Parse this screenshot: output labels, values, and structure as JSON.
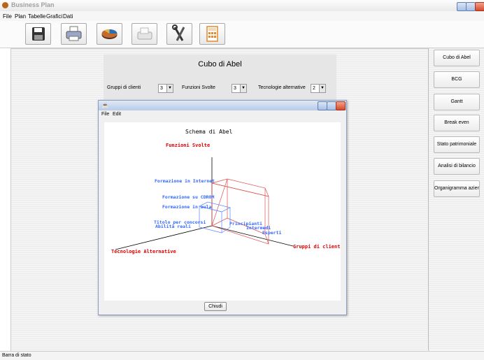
{
  "window": {
    "title": "Business Plan"
  },
  "menu": {
    "items": [
      "File",
      "Plan",
      "Tabelle",
      "Grafici",
      "Dati"
    ]
  },
  "toolbar": {
    "buttons": [
      {
        "name": "save-button",
        "icon": "floppy-disk-icon"
      },
      {
        "name": "print-button",
        "icon": "printer-icon"
      },
      {
        "name": "chart-button",
        "icon": "pie-chart-icon"
      },
      {
        "name": "fax-button",
        "icon": "fax-icon"
      },
      {
        "name": "tools-button",
        "icon": "tools-icon"
      },
      {
        "name": "calculator-button",
        "icon": "calculator-icon"
      }
    ]
  },
  "panel": {
    "title": "Cubo di Abel",
    "combos": [
      {
        "label": "Gruppi di clienti",
        "value": "3"
      },
      {
        "label": "Funzioni Svolte",
        "value": "3"
      },
      {
        "label": "Tecnologie alternative",
        "value": "2"
      }
    ]
  },
  "sidebar": {
    "items": [
      "Cubo di Abel",
      "BCG",
      "Gantt",
      "Break even",
      "Stato patrimoniale",
      "Analisi di bilancio",
      "Organigramma aziendale"
    ]
  },
  "dialog": {
    "menu": [
      "File",
      "Edit"
    ],
    "close_label": "Chiudi"
  },
  "chart_data": {
    "type": "other",
    "title": "Schema di Abel",
    "axes": {
      "vertical": "Funzioni Svolte",
      "right": "Gruppi di clienti",
      "left": "Tecnologie Alternative"
    },
    "vertical_items": [
      "Formazione in Internet",
      "Formazione su CDROM",
      "Formazione in aula"
    ],
    "left_items": [
      "Titolo per concorsi",
      "Abilità reali"
    ],
    "right_items": [
      "Principianti",
      "Intermedi",
      "Esperti"
    ]
  },
  "status": {
    "text": "Barra di stato"
  },
  "colors": {
    "axis_label": "#e00000",
    "item_label": "#3366ff",
    "cube_outer": "#e05050",
    "cube_inner": "#5588ff"
  }
}
